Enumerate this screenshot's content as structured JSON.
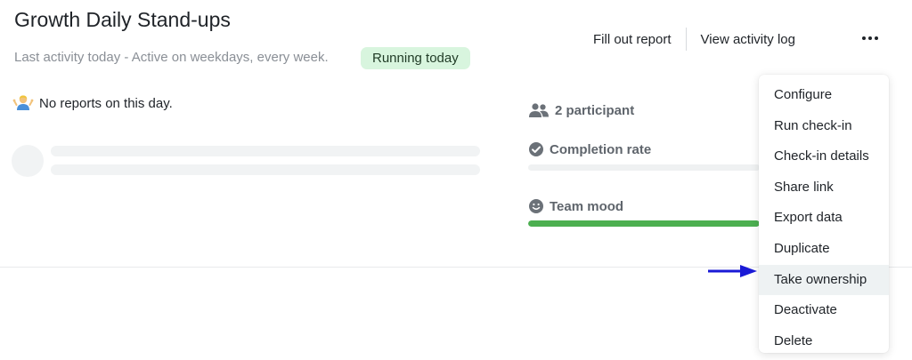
{
  "header": {
    "title": "Growth Daily Stand-ups",
    "subtitle": "Last activity today - Active on weekdays, every week.",
    "status_badge": "Running today",
    "fill_report": "Fill out report",
    "view_log": "View activity log",
    "more_icon": "more-horizontal-icon"
  },
  "reports": {
    "empty_text": "No reports on this day.",
    "empty_icon": "person-shrugging-emoji"
  },
  "stats": {
    "participants": "2 participant",
    "completion_label": "Completion rate",
    "completion_value": 0,
    "mood_label": "Team mood",
    "mood_value": 1
  },
  "menu": {
    "items": [
      {
        "label": "Configure"
      },
      {
        "label": "Run check-in"
      },
      {
        "label": "Check-in details"
      },
      {
        "label": "Share link"
      },
      {
        "label": "Export data"
      },
      {
        "label": "Duplicate"
      },
      {
        "label": "Take ownership",
        "highlighted": true
      },
      {
        "label": "Deactivate"
      },
      {
        "label": "Delete"
      }
    ]
  },
  "colors": {
    "badge_bg": "#d8f5de",
    "mood_bar": "#4caf50",
    "arrow": "#1a1ad6"
  }
}
